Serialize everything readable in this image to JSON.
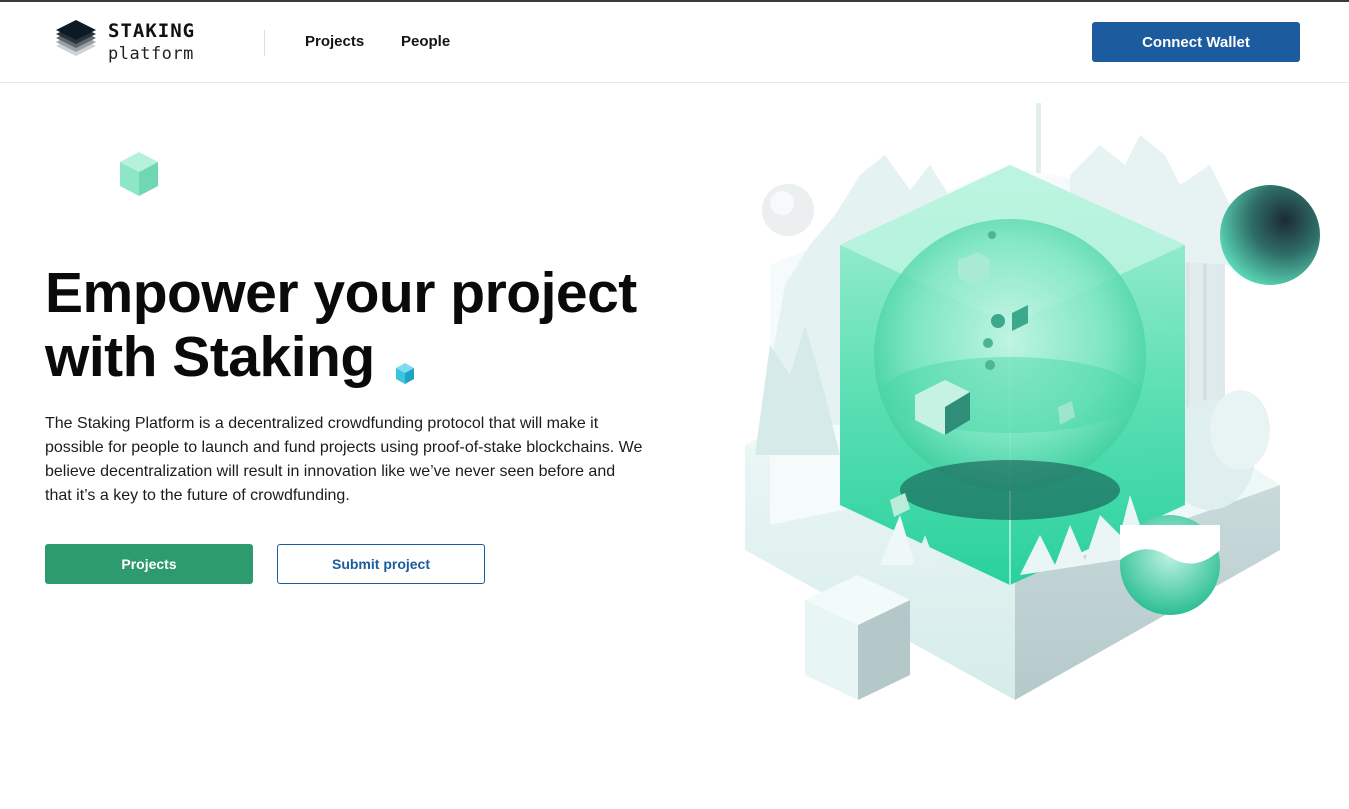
{
  "brand": {
    "line1": "STAKING",
    "line2": "platform",
    "logo_icon": "stacked-layers-logo-icon"
  },
  "nav": {
    "items": [
      {
        "label": "Projects"
      },
      {
        "label": "People"
      }
    ],
    "connect_wallet_label": "Connect Wallet"
  },
  "hero": {
    "title": "Empower your project with Staking",
    "description": "The Staking Platform is a decentralized crowdfunding protocol that will make it possible for people to launch and fund projects using proof-of-stake blockchains. We believe decentralization will result in innovation like we’ve never seen before and that it’s a key to the future of crowdfunding.",
    "primary_button": "Projects",
    "secondary_button": "Submit project",
    "illustration_icon": "isometric-crystal-cube-illustration"
  },
  "colors": {
    "primary_blue": "#1b5b9e",
    "primary_green": "#2e9b6e",
    "accent_mint": "#7de3c0",
    "accent_cyan": "#31b8d6"
  }
}
